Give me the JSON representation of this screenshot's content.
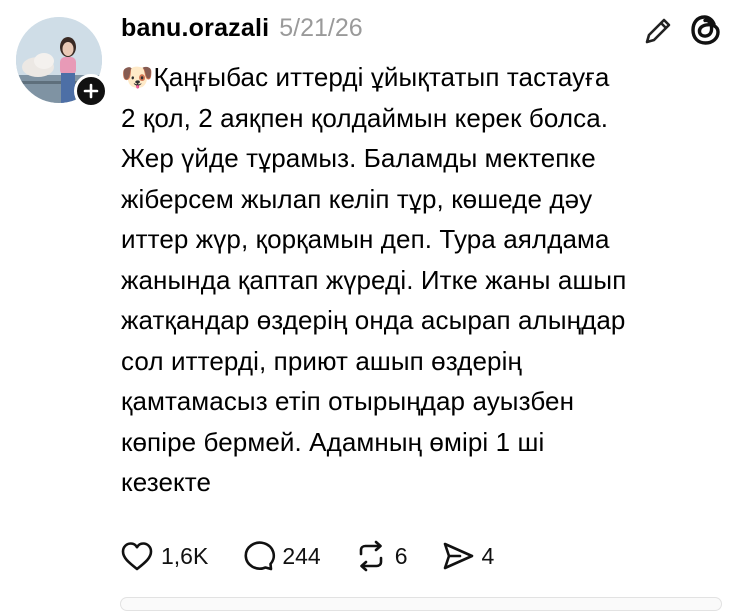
{
  "post": {
    "author": "banu.orazali",
    "timestamp": "5/21/26",
    "text": "🐶Қаңғыбас иттерді ұйықтатып тастауға\n2 қол, 2 аяқпен қолдаймын керек болса.\nЖер үйде тұрамыз. Баламды мектепке\nжіберсем жылап келіп тұр, көшеде дәу\nиттер жүр, қорқамын деп. Тура аялдама\nжанында қаптап жүреді. Итке жаны ашып\nжатқандар өздерің онда асырап алыңдар\nсол иттерді, приют ашып өздерің\nқамтамасыз етіп отырыңдар ауызбен\nкөпіре бермей. Адамның өмірі 1 ші\nкезекте"
  },
  "actions": {
    "likes": "1,6K",
    "replies": "244",
    "reposts": "6",
    "shares": "4"
  },
  "icons": {
    "avatar_plus": "plus-icon",
    "edit": "edit-pencil-icon",
    "logo": "threads-logo-icon",
    "like": "heart-icon",
    "reply": "comment-icon",
    "repost": "repost-icon",
    "share": "send-icon"
  }
}
